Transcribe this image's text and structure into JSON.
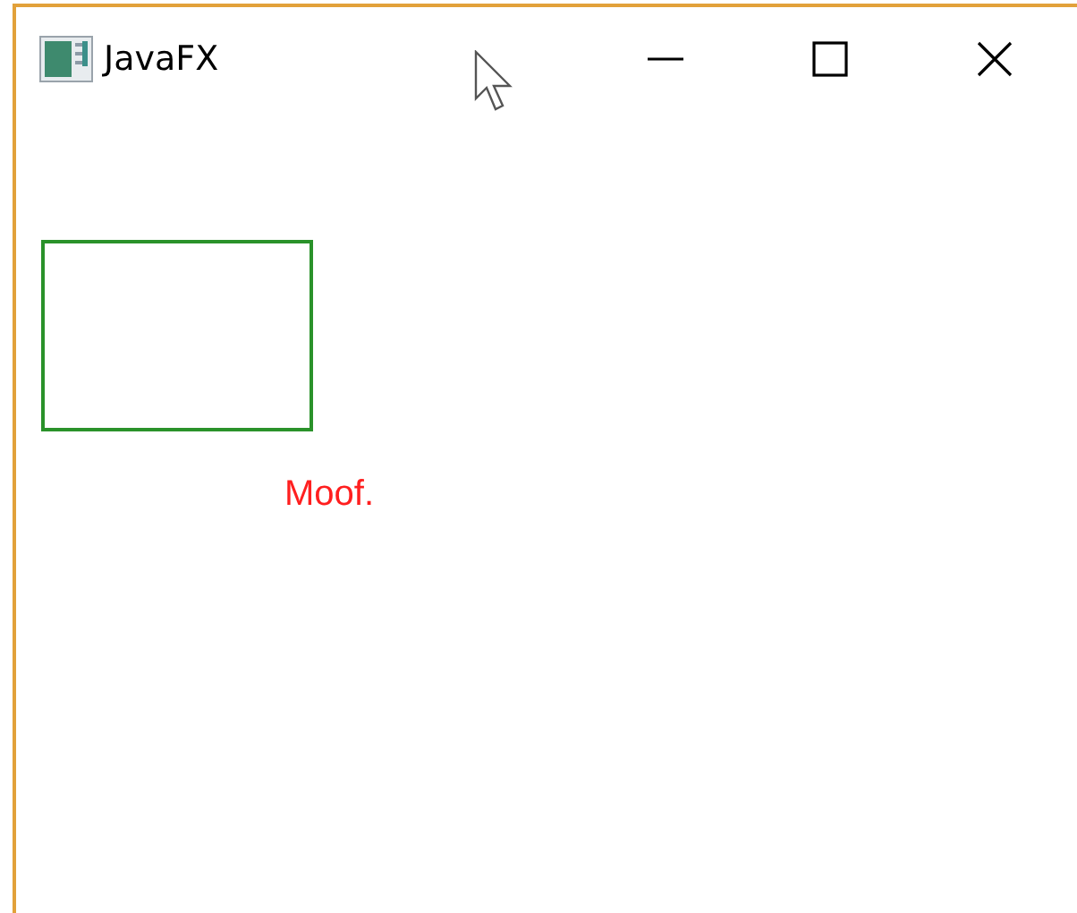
{
  "window": {
    "title": "JavaFX"
  },
  "content": [
    {
      "kind": "rectangle",
      "color": "#2a922a"
    },
    {
      "kind": "label",
      "text": "Moof.",
      "color": "#ff1f1f"
    }
  ]
}
